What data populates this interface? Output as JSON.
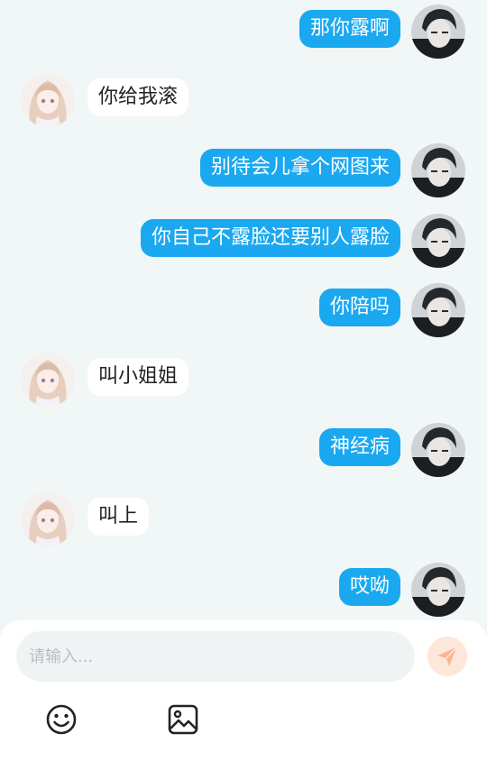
{
  "messages": [
    {
      "side": "me",
      "text": "那你露啊"
    },
    {
      "side": "other",
      "text": "你给我滚"
    },
    {
      "side": "me",
      "text": "别待会儿拿个网图来"
    },
    {
      "side": "me",
      "text": "你自己不露脸还要别人露脸"
    },
    {
      "side": "me",
      "text": "你陪吗"
    },
    {
      "side": "other",
      "text": "叫小姐姐"
    },
    {
      "side": "me",
      "text": "神经病"
    },
    {
      "side": "other",
      "text": "叫上"
    },
    {
      "side": "me",
      "text": "哎呦"
    }
  ],
  "composer": {
    "placeholder": "请输入...",
    "value": "",
    "send_icon": "send-icon",
    "emoji_icon": "emoji-icon",
    "image_icon": "image-icon"
  },
  "colors": {
    "background": "#f1f6f7",
    "my_bubble": "#1aa8f0",
    "other_bubble": "#ffffff",
    "send_button": "#fde6da",
    "send_arrow": "#f8b592"
  }
}
